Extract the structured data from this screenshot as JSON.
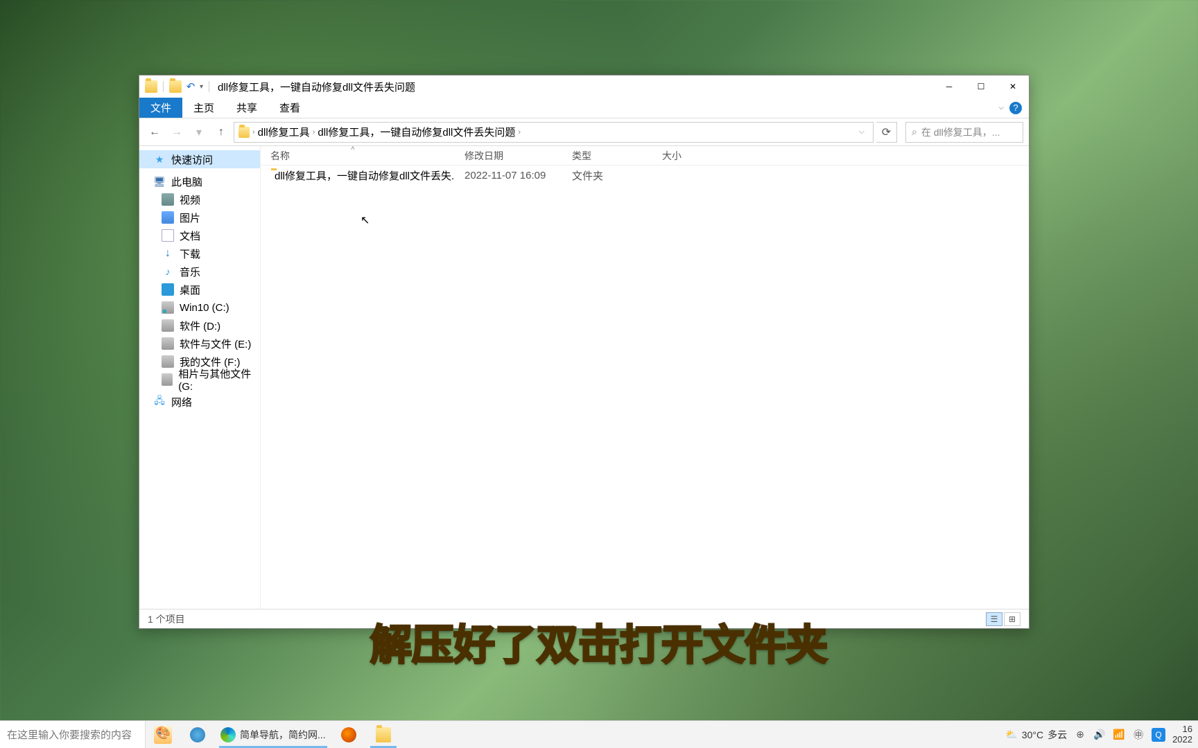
{
  "window": {
    "title": "dll修复工具，一键自动修复dll文件丢失问题"
  },
  "ribbon": {
    "file": "文件",
    "home": "主页",
    "share": "共享",
    "view": "查看"
  },
  "breadcrumb": {
    "seg1": "dll修复工具",
    "seg2": "dll修复工具，一键自动修复dll文件丢失问题"
  },
  "search": {
    "placeholder": "在 dll修复工具，..."
  },
  "sidebar": {
    "quick": "快速访问",
    "pc": "此电脑",
    "video": "视频",
    "pictures": "图片",
    "documents": "文档",
    "downloads": "下载",
    "music": "音乐",
    "desktop": "桌面",
    "c": "Win10 (C:)",
    "d": "软件 (D:)",
    "e": "软件与文件 (E:)",
    "f": "我的文件 (F:)",
    "g": "相片与其他文件 (G:",
    "network": "网络"
  },
  "columns": {
    "name": "名称",
    "date": "修改日期",
    "type": "类型",
    "size": "大小"
  },
  "rows": [
    {
      "name": "dll修复工具，一键自动修复dll文件丢失...",
      "date": "2022-11-07 16:09",
      "type": "文件夹",
      "size": ""
    }
  ],
  "status": {
    "count": "1 个项目"
  },
  "subtitle": "解压好了双击打开文件夹",
  "taskbar": {
    "search": "在这里输入你要搜索的内容",
    "edge_label": "简单导航，简约网...",
    "weather_temp": "30°C",
    "weather_desc": "多云",
    "time": "16",
    "date": "2022"
  }
}
